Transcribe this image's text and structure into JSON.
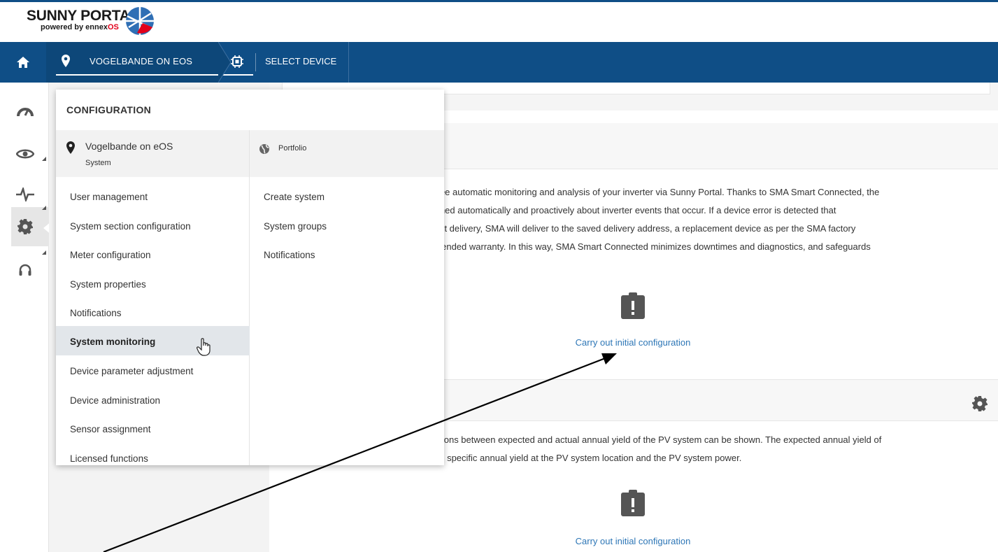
{
  "header": {
    "logo_main": "SUNNY PORTAL",
    "logo_sub_prefix": "powered by ennex",
    "logo_sub_suffix": "OS"
  },
  "nav": {
    "system_crumb": "VOGELBANDE ON EOS",
    "device_crumb": "SELECT DEVICE"
  },
  "menu": {
    "title": "CONFIGURATION",
    "system": {
      "name": "Vogelbande on eOS",
      "type": "System"
    },
    "portfolio": {
      "name": "Portfolio"
    },
    "left_items": [
      "User management",
      "System section configuration",
      "Meter configuration",
      "System properties",
      "Notifications",
      "System monitoring",
      "Device parameter adjustment",
      "Device administration",
      "Sensor assignment",
      "Licensed functions"
    ],
    "active_item": "System monitoring",
    "right_items": [
      "Create system",
      "System groups",
      "Notifications"
    ]
  },
  "content": {
    "smart_connected_lines": [
      "free automatic monitoring and analysis of your inverter via Sunny Portal. Thanks to SMA Smart Connected, the",
      "rmed automatically and proactively about inverter events that occur. If a device error is detected that",
      "ent delivery, SMA will deliver to the saved delivery address, a replacement device as per the SMA factory",
      "xtended warranty. In this way, SMA Smart Connected minimizes downtimes and diagnostics, and safeguards"
    ],
    "link_1": "Carry out initial configuration",
    "yield_lines": [
      "ations between expected and actual annual yield of the PV system can be shown. The expected annual yield of",
      "he specific annual yield at the PV system location and the PV system power."
    ],
    "link_2": "Carry out initial configuration"
  },
  "colors": {
    "navbar": "#0f4e86",
    "link": "#2d76b6",
    "active_menu_bg": "#e2e6ea"
  }
}
